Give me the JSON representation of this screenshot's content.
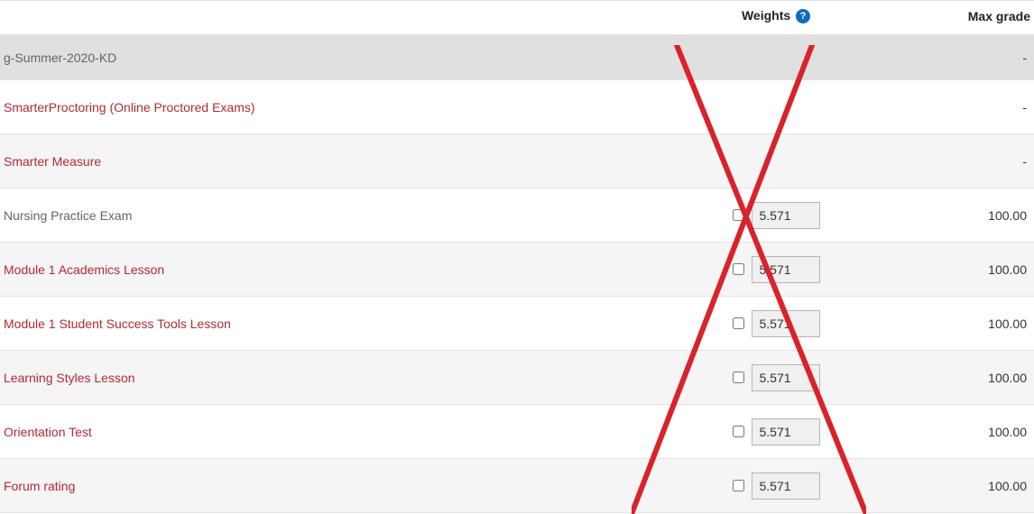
{
  "headers": {
    "name": "",
    "weights": "Weights",
    "maxgrade": "Max grade"
  },
  "help_icon_glyph": "?",
  "category": {
    "name": "g-Summer-2020-KD",
    "maxgrade": "-"
  },
  "items": [
    {
      "label": "SmarterProctoring (Online Proctored Exams)",
      "kind": "link",
      "weight": null,
      "maxgrade": "-"
    },
    {
      "label": "Smarter Measure",
      "kind": "link",
      "weight": null,
      "maxgrade": "-"
    },
    {
      "label": "Nursing Practice Exam",
      "kind": "text",
      "weight": "5.571",
      "maxgrade": "100.00"
    },
    {
      "label": "Module 1 Academics Lesson",
      "kind": "link",
      "weight": "5.571",
      "maxgrade": "100.00"
    },
    {
      "label": "Module 1 Student Success Tools Lesson",
      "kind": "link",
      "weight": "5.571",
      "maxgrade": "100.00"
    },
    {
      "label": "Learning Styles Lesson",
      "kind": "link",
      "weight": "5.571",
      "maxgrade": "100.00"
    },
    {
      "label": "Orientation Test",
      "kind": "link",
      "weight": "5.571",
      "maxgrade": "100.00"
    },
    {
      "label": "Forum rating",
      "kind": "link",
      "weight": "5.571",
      "maxgrade": "100.00"
    }
  ]
}
